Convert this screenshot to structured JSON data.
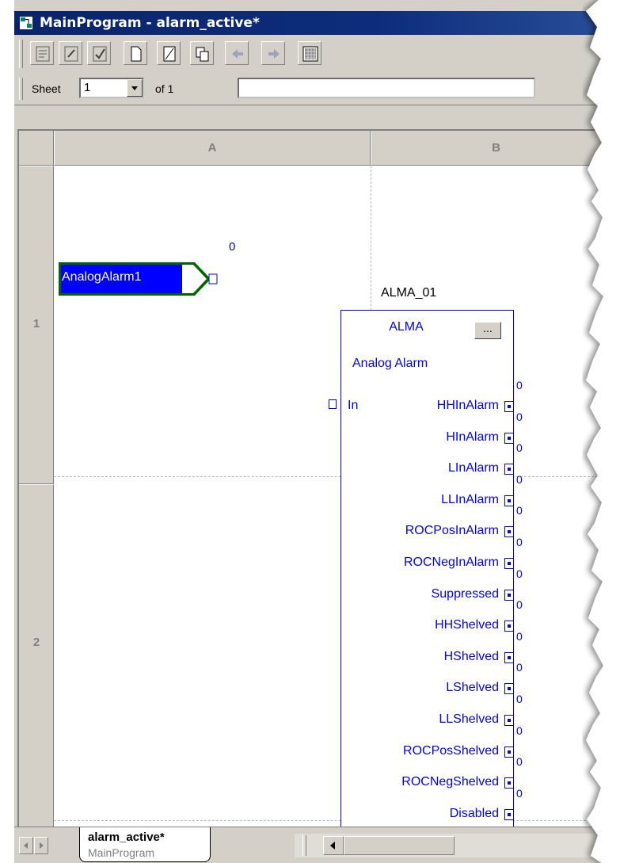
{
  "window": {
    "title": "MainProgram - alarm_active*"
  },
  "toolbar": {
    "buttons": [
      {
        "name": "properties-button",
        "icon": "properties-icon"
      },
      {
        "name": "edit-button",
        "icon": "edit-icon"
      },
      {
        "name": "verify-button",
        "icon": "verify-icon"
      },
      {
        "name": "new-sheet-button",
        "icon": "new-sheet-icon"
      },
      {
        "name": "delete-sheet-button",
        "icon": "delete-sheet-icon"
      },
      {
        "name": "copy-sheet-button",
        "icon": "copy-sheet-icon"
      },
      {
        "name": "previous-sheet-button",
        "icon": "arrow-left-icon"
      },
      {
        "name": "next-sheet-button",
        "icon": "arrow-right-icon"
      },
      {
        "name": "grid-toggle-button",
        "icon": "grid-icon"
      }
    ]
  },
  "sheetbar": {
    "label": "Sheet",
    "current": "1",
    "of_text": "of 1",
    "description": ""
  },
  "columns": [
    "A",
    "B"
  ],
  "rows": [
    "1",
    "2"
  ],
  "tag_block": {
    "label": "AnalogAlarm1",
    "value": "0"
  },
  "function_block": {
    "name": "ALMA_01",
    "type": "ALMA",
    "config_button": "...",
    "description": "Analog Alarm",
    "input": "In",
    "outputs": [
      {
        "label": "HHInAlarm",
        "value": "0"
      },
      {
        "label": "HInAlarm",
        "value": "0"
      },
      {
        "label": "LInAlarm",
        "value": "0"
      },
      {
        "label": "LLInAlarm",
        "value": "0"
      },
      {
        "label": "ROCPosInAlarm",
        "value": "0"
      },
      {
        "label": "ROCNegInAlarm",
        "value": "0"
      },
      {
        "label": "Suppressed",
        "value": "0"
      },
      {
        "label": "HHShelved",
        "value": "0"
      },
      {
        "label": "HShelved",
        "value": "0"
      },
      {
        "label": "LShelved",
        "value": "0"
      },
      {
        "label": "LLShelved",
        "value": "0"
      },
      {
        "label": "ROCPosShelved",
        "value": "0"
      },
      {
        "label": "ROCNegShelved",
        "value": "0"
      },
      {
        "label": "Disabled",
        "value": "0"
      }
    ]
  },
  "tabs": [
    {
      "name": "alarm_active*",
      "program": "MainProgram"
    }
  ],
  "colors": {
    "titlebar": "#0a246a",
    "tag_fill": "#0000ff",
    "tag_border": "#006400",
    "wire_blue": "#0000ff",
    "chrome": "#d4d0c8"
  }
}
